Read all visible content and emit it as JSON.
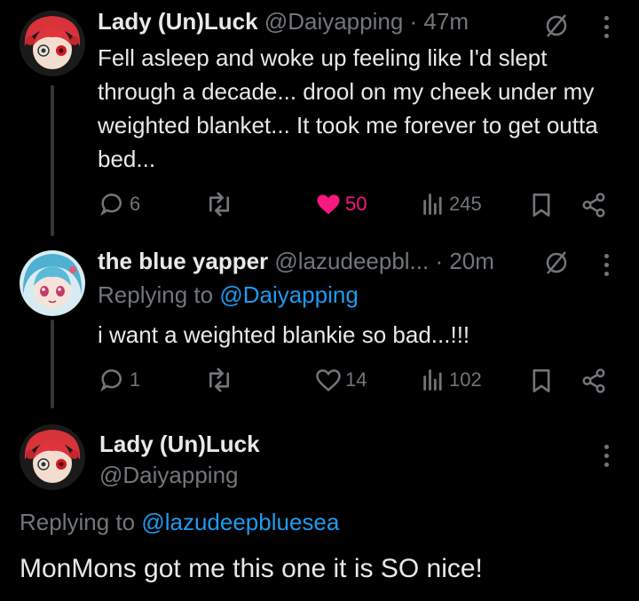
{
  "tweets": [
    {
      "name": "Lady (Un)Luck",
      "handle": "@Daiyapping",
      "time": "· 47m",
      "text": "Fell asleep and woke up feeling like I'd slept through a decade... drool on my cheek under my weighted blanket... It took me forever to get outta bed...",
      "replies": "6",
      "retweets": "",
      "likes": "50",
      "views": "245"
    },
    {
      "name": "the blue yapper",
      "handle": "@lazudeepbl...",
      "time": "· 20m",
      "replying_prefix": "Replying to ",
      "replying_to": "@Daiyapping",
      "text": "i want a weighted blankie so bad...!!!",
      "replies": "1",
      "retweets": "",
      "likes": "14",
      "views": "102"
    },
    {
      "name": "Lady (Un)Luck",
      "handle": "@Daiyapping",
      "replying_prefix": "Replying to ",
      "replying_to": "@lazudeepbluesea",
      "text": "MonMons got me this one it is SO nice!"
    }
  ],
  "colors": {
    "background": "#000000",
    "text": "#e7e9ea",
    "muted": "#71767b",
    "link": "#1d9bf0",
    "like": "#f91880"
  },
  "icons": [
    "reply-icon",
    "retweet-icon",
    "like-icon",
    "views-icon",
    "bookmark-icon",
    "share-icon",
    "more-icon",
    "no-sign-icon"
  ]
}
